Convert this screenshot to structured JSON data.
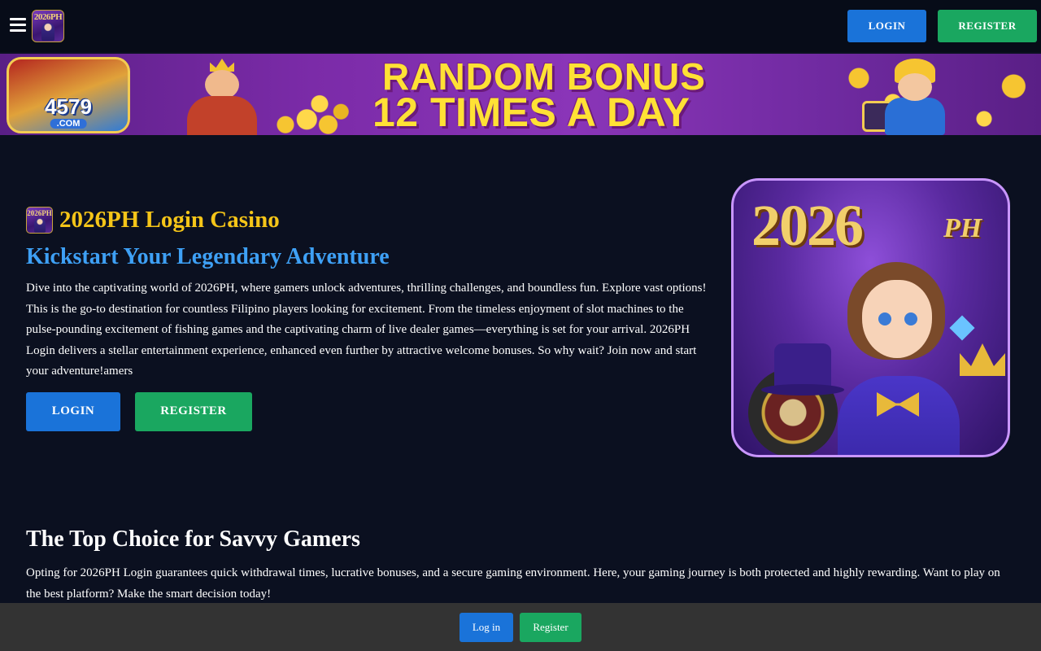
{
  "header": {
    "menu_icon": "hamburger-icon",
    "logo_text": "2026PH",
    "login_label": "LOGIN",
    "register_label": "REGISTER"
  },
  "banner": {
    "logo_text": "4579",
    "logo_sub": ".COM",
    "line1": "RANDOM BONUS",
    "line2": "12 TIMES A DAY"
  },
  "hero": {
    "icon_text": "2026PH",
    "title": "2026PH Login Casino",
    "subtitle": "Kickstart Your Legendary Adventure",
    "paragraph": "Dive into the captivating world of 2026PH, where gamers unlock adventures, thrilling challenges, and boundless fun. Explore vast options! This is the go-to destination for countless Filipino players looking for excitement. From the timeless enjoyment of slot machines to the pulse-pounding excitement of fishing games and the captivating charm of live dealer games—everything is set for your arrival. 2026PH Login delivers a stellar entertainment experience, enhanced even further by attractive welcome bonuses. So why wait? Join now and start your adventure!amers",
    "login_label": "LOGIN",
    "register_label": "REGISTER",
    "image_title": "2026",
    "image_sub": "PH"
  },
  "section2": {
    "heading": "The Top Choice for Savvy Gamers",
    "paragraph": "Opting for 2026PH Login guarantees quick withdrawal times, lucrative bonuses, and a secure gaming environment. Here, your gaming journey is both protected and highly rewarding. Want to play on the best platform? Make the smart decision today!"
  },
  "bottom_bar": {
    "login_label": "Log in",
    "register_label": "Register"
  },
  "colors": {
    "background": "#0b1020",
    "header": "#070c18",
    "login_blue": "#1a73d9",
    "register_green": "#1aa760",
    "title_gold": "#f5c518",
    "subtitle_blue": "#3ea0f5",
    "bottom_bar": "#333333"
  }
}
